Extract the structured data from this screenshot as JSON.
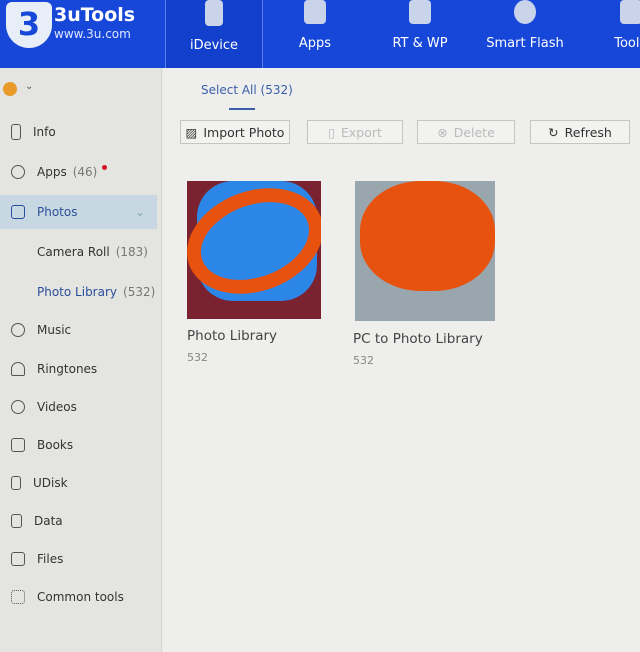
{
  "app": {
    "name": "3uTools",
    "url": "www.3u.com",
    "logo_text": "3"
  },
  "nav": [
    {
      "label": "iDevice"
    },
    {
      "label": "Apps"
    },
    {
      "label": "RT & WP"
    },
    {
      "label": "Smart Flash"
    },
    {
      "label": "Toolb"
    }
  ],
  "sidebar": {
    "items": [
      {
        "label": "Info"
      },
      {
        "label": "Apps",
        "count": "(46)"
      },
      {
        "label": "Photos"
      },
      {
        "label": "Music"
      },
      {
        "label": "Ringtones"
      },
      {
        "label": "Videos"
      },
      {
        "label": "Books"
      },
      {
        "label": "UDisk"
      },
      {
        "label": "Data"
      },
      {
        "label": "Files"
      },
      {
        "label": "Common tools"
      }
    ],
    "sub": [
      {
        "label": "Camera Roll",
        "count": "(183)"
      },
      {
        "label": "Photo Library",
        "count": "(532)"
      }
    ]
  },
  "main": {
    "select_all": "Select All (532)",
    "toolbar": {
      "import": "Import Photo",
      "export": "Export",
      "delete": "Delete",
      "refresh": "Refresh"
    },
    "albums": [
      {
        "name": "Photo Library",
        "count": "532"
      },
      {
        "name": "PC to Photo Library",
        "count": "532"
      }
    ]
  },
  "colors": {
    "brand": "#1747d8",
    "badge": "#d8102a",
    "scribble": "#e8520f"
  }
}
